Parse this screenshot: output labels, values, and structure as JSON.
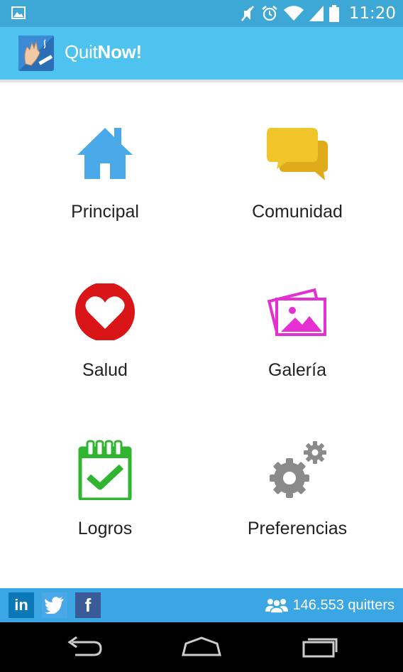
{
  "status_bar": {
    "time": "11:20",
    "icons": [
      "picture-icon",
      "mute-icon",
      "alarm-icon",
      "wifi-icon",
      "signal-icon",
      "battery-icon"
    ]
  },
  "app_bar": {
    "title_part1": "Quit",
    "title_part2": "Now!",
    "logo": "quitnow-logo"
  },
  "menu": {
    "items": [
      {
        "label": "Principal",
        "icon": "home-icon",
        "color": "#4aa9e8"
      },
      {
        "label": "Comunidad",
        "icon": "chat-icon",
        "color": "#f0c52a"
      },
      {
        "label": "Salud",
        "icon": "heart-icon",
        "color": "#d91518"
      },
      {
        "label": "Galería",
        "icon": "gallery-icon",
        "color": "#e62fd2"
      },
      {
        "label": "Logros",
        "icon": "achievement-calendar-icon",
        "color": "#2fb52f"
      },
      {
        "label": "Preferencias",
        "icon": "gears-icon",
        "color": "#8a8a8a"
      }
    ]
  },
  "bottom_bar": {
    "linkedin_label": "in",
    "facebook_label": "f",
    "quitters_count": "146.553 quitters"
  },
  "nav_bar": {
    "buttons": [
      "back-icon",
      "home-icon",
      "recents-icon"
    ]
  },
  "colors": {
    "status_bar": "#3da7d6",
    "app_bar": "#4ec3ef",
    "bottom_bar": "#3aa6e3",
    "nav_bar": "#000000"
  }
}
